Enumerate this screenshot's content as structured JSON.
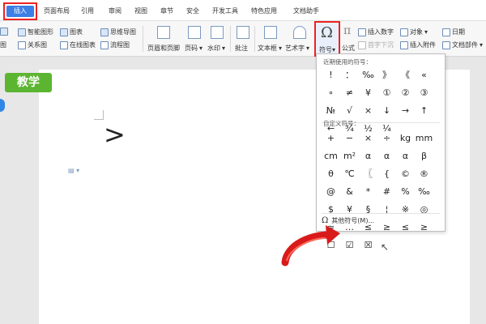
{
  "tabs": [
    {
      "label": "插入",
      "active": true
    },
    {
      "label": "页面布局"
    },
    {
      "label": "引用"
    },
    {
      "label": "审阅"
    },
    {
      "label": "视图"
    },
    {
      "label": "章节"
    },
    {
      "label": "安全"
    },
    {
      "label": "开发工具"
    },
    {
      "label": "特色应用"
    },
    {
      "label": "文档助手"
    }
  ],
  "toolbar": {
    "smartart": "智能图形",
    "chart": "图表",
    "mindmap": "思维导图",
    "relation": "关系图",
    "online_chart": "在线图表",
    "flowchart": "流程图",
    "header_footer": "页眉和页脚",
    "page_number": "页码",
    "watermark": "水印",
    "comment": "批注",
    "textbox": "文本框",
    "wordart": "艺术字",
    "symbol": "符号",
    "formula": "公式",
    "insert_number": "插入数字",
    "object": "对象",
    "first_letter_sink": "首字下沉",
    "insert_attachment": "插入附件",
    "date": "日期",
    "doc_parts": "文档部件",
    "left_cut": "图"
  },
  "panel": {
    "recent_title": "近期使用的符号：",
    "recent_symbols": [
      "!",
      "：",
      "‰",
      "》",
      "《",
      "«",
      "∘",
      "≠",
      "¥",
      "①",
      "②",
      "③",
      "№",
      "√",
      "×",
      "↓",
      "→",
      "↑",
      "←",
      "¾",
      "½",
      "¼"
    ],
    "custom_title": "自定义符号：",
    "custom_symbols": [
      "+",
      "−",
      "×",
      "÷",
      "kg",
      "mm",
      "cm",
      "m²",
      "α",
      "α",
      "α",
      "β",
      "θ",
      "℃",
      "〖",
      "{",
      "©",
      "®",
      "@",
      "&",
      "*",
      "#",
      "%",
      "‰",
      "$",
      "¥",
      "§",
      "¦",
      "※",
      "◎",
      "≈",
      "…",
      "≤",
      "≥",
      "≤",
      "≥",
      "☐",
      "☑",
      "☒",
      ""
    ],
    "more_symbols": "其他符号(M)..."
  },
  "document": {
    "content": ">",
    "badge": "教学"
  }
}
